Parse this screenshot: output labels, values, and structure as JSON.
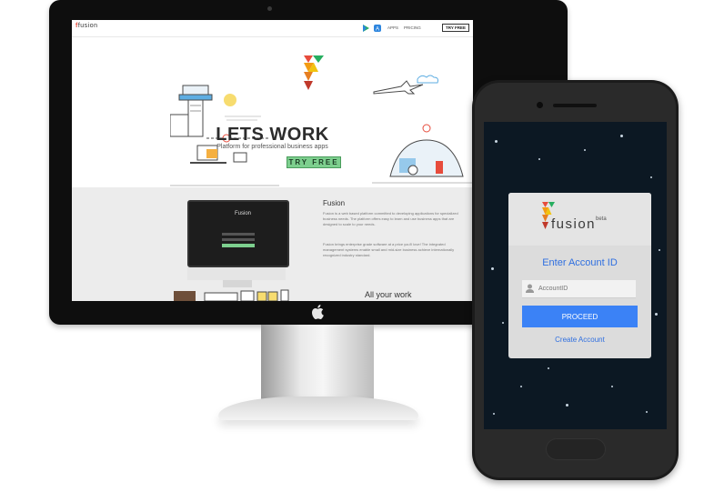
{
  "desktop": {
    "nav": {
      "logo": "fusion",
      "links": [
        "APPS",
        "PRICING"
      ],
      "try_label": "TRY FREE"
    },
    "hero": {
      "title": "LETS WORK",
      "subtitle": "Platform for professional business apps",
      "cta": "TRY FREE"
    },
    "about": {
      "title": "Fusion",
      "paragraph1": "Fusion is a web based platform committed to developing applications for specialized business needs. The platform offers easy to learn and use business apps that are designed to scale to your needs.",
      "paragraph2": "Fusion brings enterprise grade software at a price you'll love! The integrated management systems enable small and mid-size business achieve internationally recognized industry standard."
    },
    "section3_title": "All your work",
    "laptop_brand": "Fusion"
  },
  "mobile": {
    "brand": "fusion",
    "beta": "beta",
    "heading": "Enter Account ID",
    "input_placeholder": "AccountID",
    "proceed_label": "PROCEED",
    "create_link": "Create Account"
  },
  "colors": {
    "accent_blue": "#3b82f6",
    "link_blue": "#2f6fe0",
    "cta_green": "#7dcf8e",
    "phone_bg": "#0c1823"
  }
}
